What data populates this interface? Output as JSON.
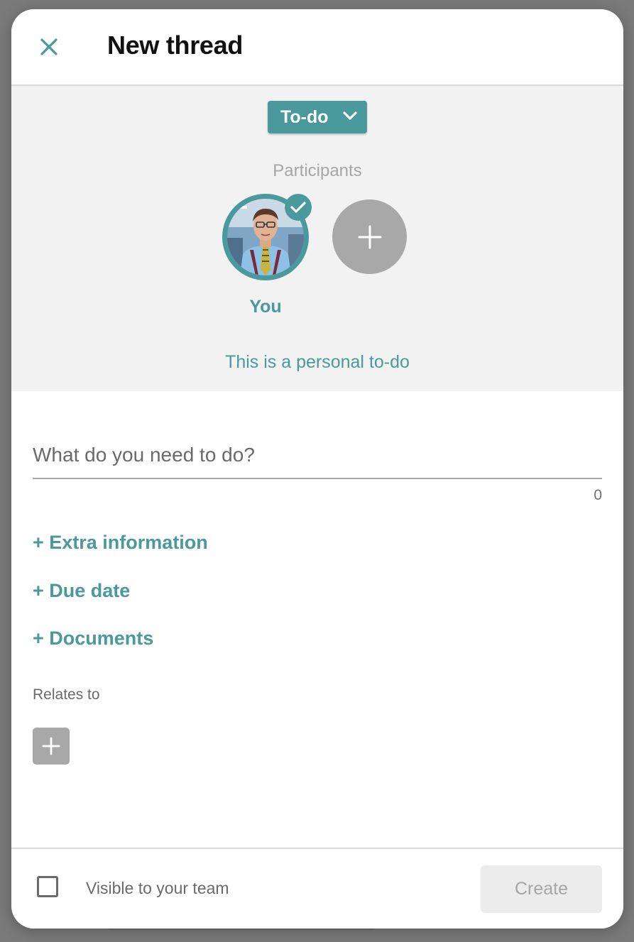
{
  "header": {
    "title": "New thread",
    "close_icon": "close-icon"
  },
  "thread_type": {
    "selected": "To-do",
    "icon": "chevron-down-icon"
  },
  "participants": {
    "label": "Participants",
    "items": [
      {
        "label": "You",
        "selected": true,
        "icon": "check-icon"
      }
    ],
    "add_icon": "plus-icon"
  },
  "personal_note": "This is a personal to-do",
  "task": {
    "placeholder": "What do you need to do?",
    "value": "",
    "char_count": "0"
  },
  "links": {
    "extra_information": "+ Extra information",
    "due_date": "+ Due date",
    "documents": "+ Documents"
  },
  "relates_to": {
    "label": "Relates to",
    "add_icon": "plus-icon"
  },
  "footer": {
    "visible_label": "Visible to your team",
    "visible_checked": false,
    "create_label": "Create"
  },
  "colors": {
    "accent": "#4a9a9d",
    "panel_bg": "#f2f2f2",
    "disabled_gray": "#a8a8a8"
  }
}
